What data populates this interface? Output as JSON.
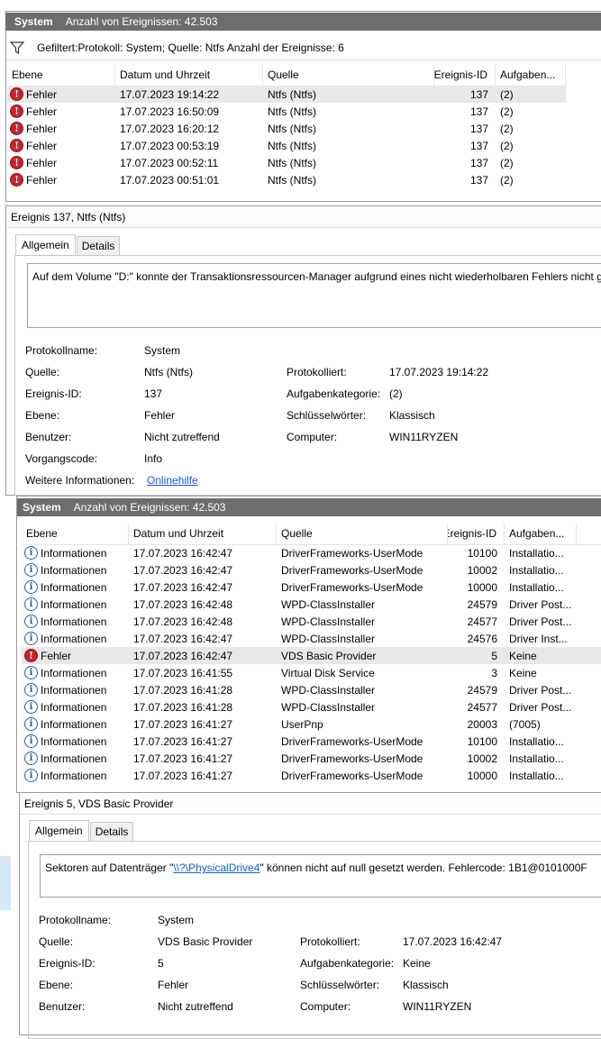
{
  "top": {
    "title": "System",
    "count_label": "Anzahl von Ereignissen: 42.503",
    "filter_text": "Gefiltert:Protokoll: System; Quelle: Ntfs Anzahl der Ereignisse: 6",
    "columns": [
      "Ebene",
      "Datum und Uhrzeit",
      "Quelle",
      "Ereignis-ID",
      "Aufgaben..."
    ],
    "rows": [
      {
        "level": "Fehler",
        "date": "17.07.2023 19:14:22",
        "source": "Ntfs (Ntfs)",
        "id": "137",
        "task": "(2)"
      },
      {
        "level": "Fehler",
        "date": "17.07.2023 16:50:09",
        "source": "Ntfs (Ntfs)",
        "id": "137",
        "task": "(2)"
      },
      {
        "level": "Fehler",
        "date": "17.07.2023 16:20:12",
        "source": "Ntfs (Ntfs)",
        "id": "137",
        "task": "(2)"
      },
      {
        "level": "Fehler",
        "date": "17.07.2023 00:53:19",
        "source": "Ntfs (Ntfs)",
        "id": "137",
        "task": "(2)"
      },
      {
        "level": "Fehler",
        "date": "17.07.2023 00:52:11",
        "source": "Ntfs (Ntfs)",
        "id": "137",
        "task": "(2)"
      },
      {
        "level": "Fehler",
        "date": "17.07.2023 00:51:01",
        "source": "Ntfs (Ntfs)",
        "id": "137",
        "task": "(2)"
      }
    ]
  },
  "detail1": {
    "title": "Ereignis 137, Ntfs (Ntfs)",
    "tab_general": "Allgemein",
    "tab_details": "Details",
    "description": "Auf dem Volume \"D:\" konnte der Transaktionsressourcen-Manager aufgrund eines nicht wiederholbaren Fehlers nicht ge",
    "labels": {
      "logname": "Protokollname:",
      "source": "Quelle:",
      "eventid": "Ereignis-ID:",
      "level": "Ebene:",
      "user": "Benutzer:",
      "opcode": "Vorgangscode:",
      "moreinfo": "Weitere Informationen:",
      "logged": "Protokolliert:",
      "category": "Aufgabenkategorie:",
      "keywords": "Schlüsselwörter:",
      "computer": "Computer:"
    },
    "values": {
      "logname": "System",
      "source": "Ntfs (Ntfs)",
      "eventid": "137",
      "level": "Fehler",
      "user": "Nicht zutreffend",
      "opcode": "Info",
      "moreinfo": "Onlinehilfe",
      "logged": "17.07.2023 19:14:22",
      "category": "(2)",
      "keywords": "Klassisch",
      "computer": "WIN11RYZEN"
    }
  },
  "second": {
    "title": "System",
    "count_label": "Anzahl von Ereignissen: 42.503",
    "columns": [
      "Ebene",
      "Datum und Uhrzeit",
      "Quelle",
      "Ereignis-ID",
      "Aufgaben..."
    ],
    "rows": [
      {
        "level": "Informationen",
        "type": "info",
        "date": "17.07.2023 16:42:47",
        "source": "DriverFrameworks-UserMode",
        "id": "10100",
        "task": "Installatio..."
      },
      {
        "level": "Informationen",
        "type": "info",
        "date": "17.07.2023 16:42:47",
        "source": "DriverFrameworks-UserMode",
        "id": "10002",
        "task": "Installatio..."
      },
      {
        "level": "Informationen",
        "type": "info",
        "date": "17.07.2023 16:42:47",
        "source": "DriverFrameworks-UserMode",
        "id": "10000",
        "task": "Installatio..."
      },
      {
        "level": "Informationen",
        "type": "info",
        "date": "17.07.2023 16:42:48",
        "source": "WPD-ClassInstaller",
        "id": "24579",
        "task": "Driver Post..."
      },
      {
        "level": "Informationen",
        "type": "info",
        "date": "17.07.2023 16:42:48",
        "source": "WPD-ClassInstaller",
        "id": "24577",
        "task": "Driver Post..."
      },
      {
        "level": "Informationen",
        "type": "info",
        "date": "17.07.2023 16:42:47",
        "source": "WPD-ClassInstaller",
        "id": "24576",
        "task": "Driver Inst..."
      },
      {
        "level": "Fehler",
        "type": "err",
        "date": "17.07.2023 16:42:47",
        "source": "VDS Basic Provider",
        "id": "5",
        "task": "Keine"
      },
      {
        "level": "Informationen",
        "type": "info",
        "date": "17.07.2023 16:41:55",
        "source": "Virtual Disk Service",
        "id": "3",
        "task": "Keine"
      },
      {
        "level": "Informationen",
        "type": "info",
        "date": "17.07.2023 16:41:28",
        "source": "WPD-ClassInstaller",
        "id": "24579",
        "task": "Driver Post..."
      },
      {
        "level": "Informationen",
        "type": "info",
        "date": "17.07.2023 16:41:28",
        "source": "WPD-ClassInstaller",
        "id": "24577",
        "task": "Driver Post..."
      },
      {
        "level": "Informationen",
        "type": "info",
        "date": "17.07.2023 16:41:27",
        "source": "UserPnp",
        "id": "20003",
        "task": "(7005)"
      },
      {
        "level": "Informationen",
        "type": "info",
        "date": "17.07.2023 16:41:27",
        "source": "DriverFrameworks-UserMode",
        "id": "10100",
        "task": "Installatio..."
      },
      {
        "level": "Informationen",
        "type": "info",
        "date": "17.07.2023 16:41:27",
        "source": "DriverFrameworks-UserMode",
        "id": "10002",
        "task": "Installatio..."
      },
      {
        "level": "Informationen",
        "type": "info",
        "date": "17.07.2023 16:41:27",
        "source": "DriverFrameworks-UserMode",
        "id": "10000",
        "task": "Installatio..."
      }
    ]
  },
  "detail2": {
    "title": "Ereignis 5, VDS Basic Provider",
    "tab_general": "Allgemein",
    "tab_details": "Details",
    "desc_before": "Sektoren auf Datenträger \"",
    "desc_link": "\\\\?\\PhysicalDrive4",
    "desc_after": "\" können nicht auf null gesetzt werden. Fehlercode: 1B1@0101000F",
    "labels": {
      "logname": "Protokollname:",
      "source": "Quelle:",
      "eventid": "Ereignis-ID:",
      "level": "Ebene:",
      "user": "Benutzer:",
      "logged": "Protokolliert:",
      "category": "Aufgabenkategorie:",
      "keywords": "Schlüsselwörter:",
      "computer": "Computer:"
    },
    "values": {
      "logname": "System",
      "source": "VDS Basic Provider",
      "eventid": "5",
      "level": "Fehler",
      "user": "Nicht zutreffend",
      "logged": "17.07.2023 16:42:47",
      "category": "Keine",
      "keywords": "Klassisch",
      "computer": "WIN11RYZEN"
    }
  },
  "icons": {
    "filter": "funnel-icon",
    "error": "error-icon",
    "info": "info-icon"
  }
}
